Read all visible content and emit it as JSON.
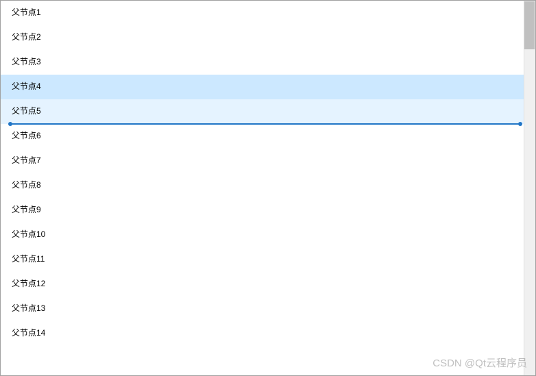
{
  "tree": {
    "items": [
      {
        "label": "父节点1",
        "state": "normal"
      },
      {
        "label": "父节点2",
        "state": "normal"
      },
      {
        "label": "父节点3",
        "state": "normal"
      },
      {
        "label": "父节点4",
        "state": "selected"
      },
      {
        "label": "父节点5",
        "state": "highlighted"
      },
      {
        "label": "父节点6",
        "state": "normal"
      },
      {
        "label": "父节点7",
        "state": "normal"
      },
      {
        "label": "父节点8",
        "state": "normal"
      },
      {
        "label": "父节点9",
        "state": "normal"
      },
      {
        "label": "父节点10",
        "state": "normal"
      },
      {
        "label": "父节点11",
        "state": "normal"
      },
      {
        "label": "父节点12",
        "state": "normal"
      },
      {
        "label": "父节点13",
        "state": "normal"
      },
      {
        "label": "父节点14",
        "state": "normal"
      }
    ],
    "drop_indicator_after_index": 4
  },
  "watermark": "CSDN @Qt云程序员"
}
